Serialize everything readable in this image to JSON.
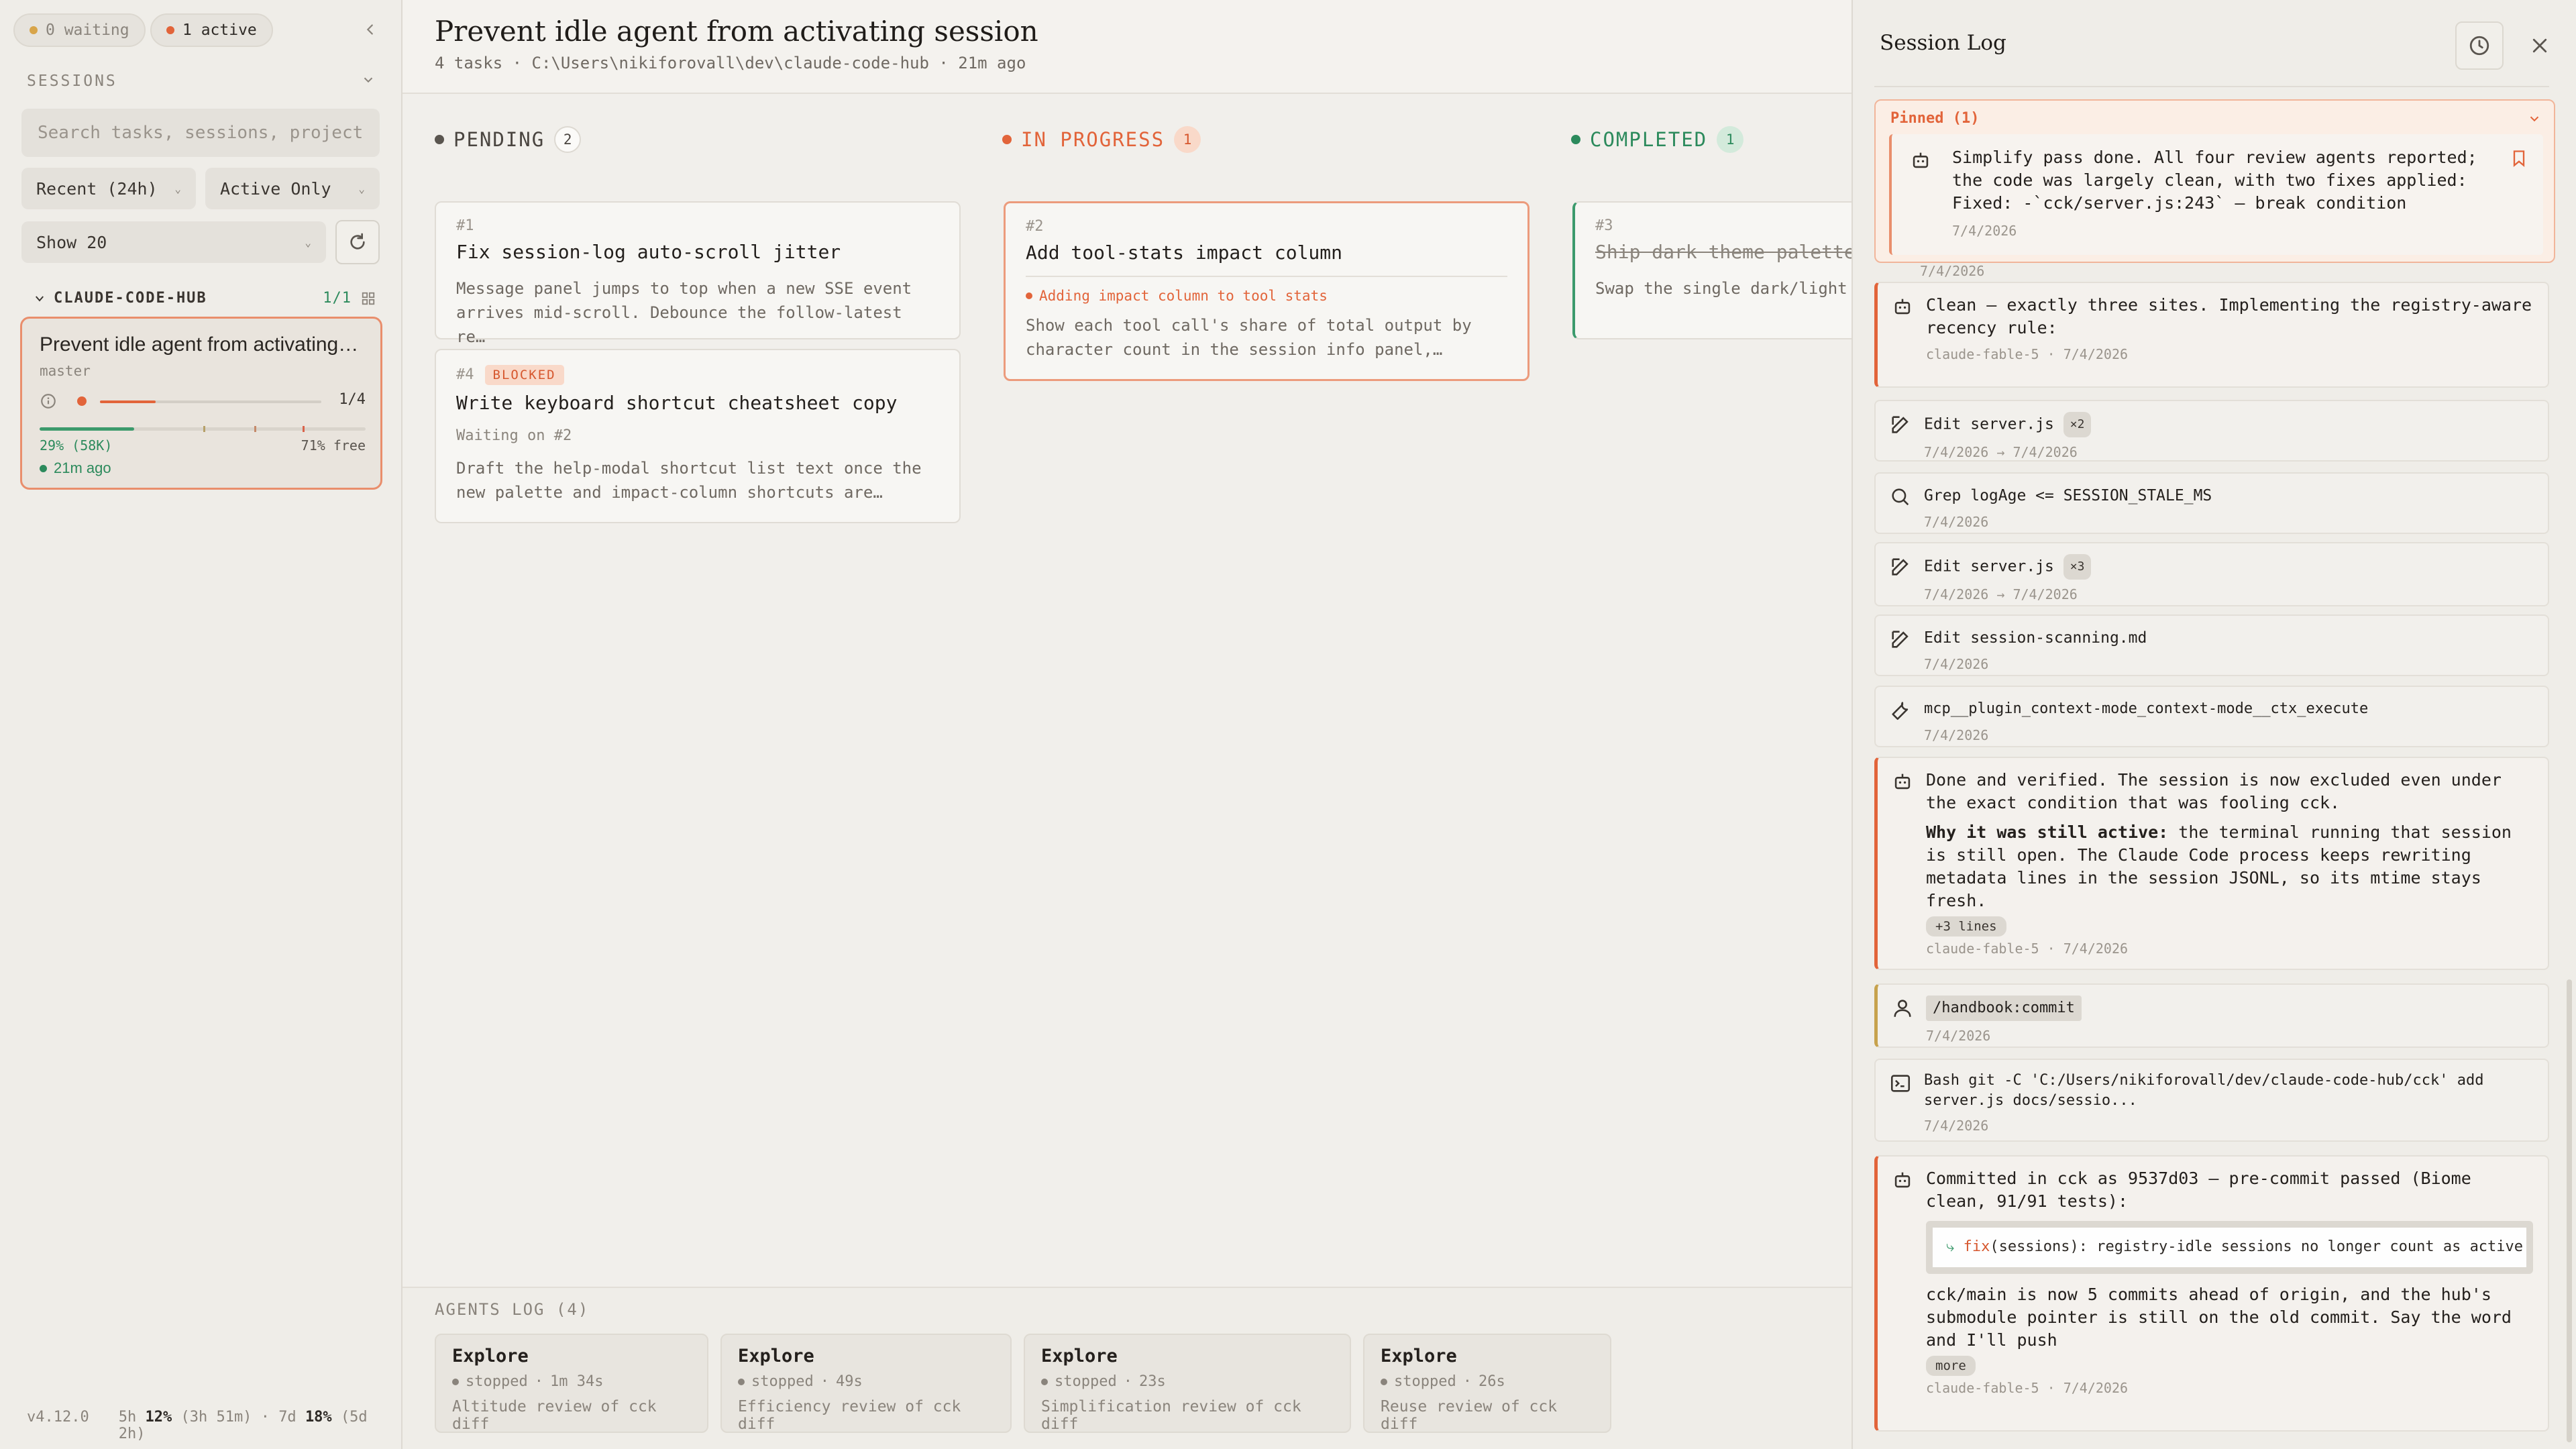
{
  "sidebar": {
    "waiting_label": "0 waiting",
    "active_label": "1 active",
    "sessions_heading": "SESSIONS",
    "search_placeholder": "Search tasks, sessions, projects",
    "filter_recent": "Recent (24h)",
    "filter_active": "Active Only",
    "filter_show": "Show 20",
    "group_name": "CLAUDE-CODE-HUB",
    "group_count": "1/1",
    "session": {
      "title": "Prevent idle agent from activating session",
      "branch": "master",
      "tasks_progress": "1/4",
      "tasks_done_fraction": 0.25,
      "context_used": "29% (58K)",
      "context_used_fraction": 0.29,
      "context_free": "71% free",
      "ago": "21m ago"
    },
    "footer": {
      "version": "v4.12.0",
      "usage_5h_label": "5h",
      "usage_5h_pct": "12%",
      "usage_5h_reset": "(3h 51m)",
      "usage_7d_label": "7d",
      "usage_7d_pct": "18%",
      "usage_7d_reset": "(5d 2h)",
      "sep": "·"
    }
  },
  "main": {
    "title": "Prevent idle agent from activating session",
    "subtitle": "4 tasks · C:\\Users\\nikiforovall\\dev\\claude-code-hub · 21m ago",
    "columns": {
      "pending": {
        "label": "PENDING",
        "count": "2"
      },
      "in_progress": {
        "label": "IN PROGRESS",
        "count": "1"
      },
      "completed": {
        "label": "COMPLETED",
        "count": "1"
      }
    },
    "tasks": {
      "t1": {
        "num": "#1",
        "title": "Fix session-log auto-scroll jitter",
        "desc": "Message panel jumps to top when a new SSE event arrives mid-scroll. Debounce the follow-latest re…"
      },
      "t4": {
        "num": "#4",
        "blocked": "BLOCKED",
        "title": "Write keyboard shortcut cheatsheet copy",
        "waiting": "Waiting on #2",
        "desc": "Draft the help-modal shortcut list text once the new palette and impact-column shortcuts are…"
      },
      "t2": {
        "num": "#2",
        "title": "Add tool-stats impact column",
        "activity": "Adding impact column to tool stats",
        "desc": "Show each tool call's share of total output by character count in the session info panel,…"
      },
      "t3": {
        "num": "#3",
        "title": "Ship dark theme palette p",
        "desc": "Swap the single dark/light accent themes, persisted pe"
      }
    },
    "agents": {
      "heading": "AGENTS LOG (4)",
      "items": [
        {
          "name": "Explore",
          "status": "stopped",
          "duration": "1m 34s",
          "desc": "Altitude review of cck diff"
        },
        {
          "name": "Explore",
          "status": "stopped",
          "duration": "49s",
          "desc": "Efficiency review of cck diff"
        },
        {
          "name": "Explore",
          "status": "stopped",
          "duration": "23s",
          "desc": "Simplification review of cck diff"
        },
        {
          "name": "Explore",
          "status": "stopped",
          "duration": "26s",
          "desc": "Reuse review of cck diff"
        }
      ]
    }
  },
  "log": {
    "title": "Session Log",
    "pinned_label": "Pinned (1)",
    "pinned": {
      "text": "Simplify pass done. All four review agents reported; the code was largely clean, with two fixes applied: Fixed: -`cck/server.js:243` — break condition `result.hasRunning…",
      "date": "7/4/2026"
    },
    "entries": {
      "e1": {
        "text": "Clean — exactly three sites. Implementing the registry-aware recency rule:",
        "meta": "claude-fable-5 · 7/4/2026"
      },
      "e2": {
        "text": "Edit server.js",
        "badge": "×2",
        "meta": "7/4/2026 → 7/4/2026"
      },
      "e3": {
        "text": "Grep logAge <= SESSION_STALE_MS",
        "meta": "7/4/2026"
      },
      "e4": {
        "text": "Edit server.js",
        "badge": "×3",
        "meta": "7/4/2026 → 7/4/2026"
      },
      "e5": {
        "text": "Edit session-scanning.md",
        "meta": "7/4/2026"
      },
      "e6": {
        "text": "mcp__plugin_context-mode_context-mode__ctx_execute",
        "meta": "7/4/2026"
      },
      "e7": {
        "text": "Done and verified. The session is now excluded even under the exact condition that was fooling cck.",
        "bold": "Why it was still active:",
        "text2": " the terminal running that session is still open. The Claude Code process keeps rewriting metadata lines in the session JSONL, so its mtime stays fresh.",
        "more": "+3 lines",
        "meta": "claude-fable-5 · 7/4/2026"
      },
      "e8": {
        "cmd": "/handbook:commit",
        "meta": "7/4/2026"
      },
      "e9": {
        "text": "Bash git -C 'C:/Users/nikiforovall/dev/claude-code-hub/cck' add server.js docs/sessio...",
        "meta": "7/4/2026"
      },
      "e10": {
        "text": "Committed in cck as 9537d03 — pre-commit passed (Biome clean, 91/91 tests):",
        "code_fix": "fix",
        "code_rest": "(sessions): registry-idle sessions no longer count as active",
        "text2": "cck/main is now 5 commits ahead of origin, and the hub's submodule pointer is still on the old commit. Say the word and I'll push",
        "more": "more",
        "meta": "claude-fable-5 · 7/4/2026"
      }
    }
  },
  "colors": {
    "accent": "#e2643a",
    "completed": "#2c8a5c",
    "pending": "#5a554f",
    "background": "#efede8"
  }
}
